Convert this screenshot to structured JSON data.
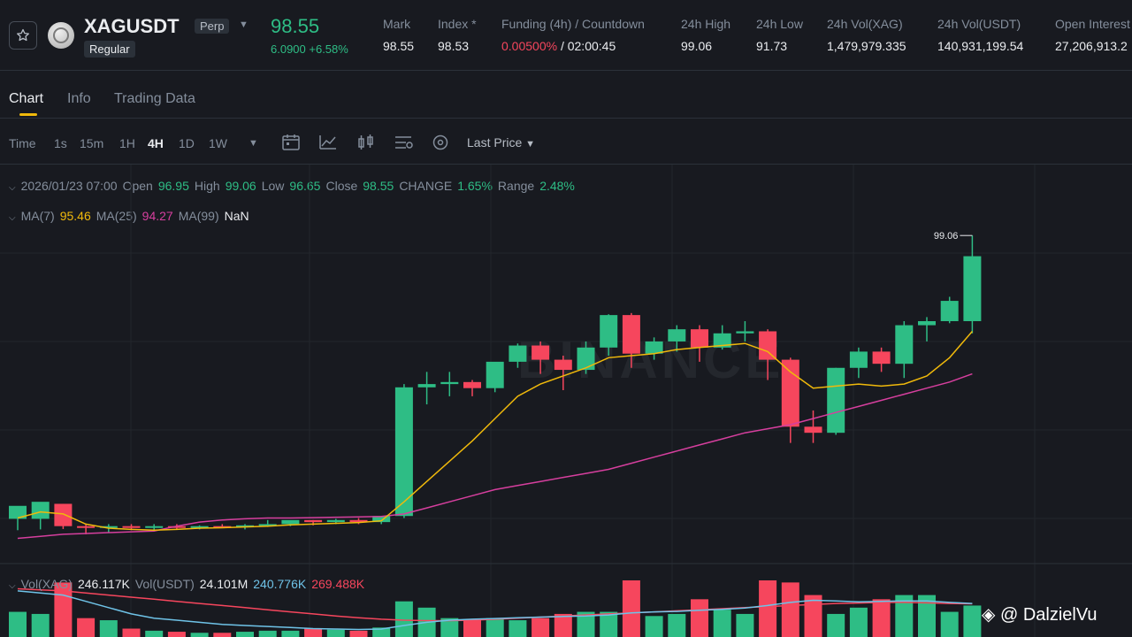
{
  "ticker": {
    "symbol": "XAGUSDT",
    "badge": "Perp",
    "category": "Regular",
    "last_price": "98.55",
    "change": "6.0900 +6.58%",
    "stats": [
      {
        "label": "Mark",
        "value": "98.55"
      },
      {
        "label": "Index *",
        "value": "98.53"
      },
      {
        "label": "Funding (4h) / Countdown",
        "value_rate": "0.00500%",
        "value_countdown": " / 02:00:45"
      },
      {
        "label": "24h High",
        "value": "99.06"
      },
      {
        "label": "24h Low",
        "value": "91.73"
      },
      {
        "label": "24h Vol(XAG)",
        "value": "1,479,979.335"
      },
      {
        "label": "24h Vol(USDT)",
        "value": "140,931,199.54"
      },
      {
        "label": "Open Interest",
        "value": "27,206,913.2"
      }
    ]
  },
  "tabs": [
    "Chart",
    "Info",
    "Trading Data"
  ],
  "toolbar": {
    "timeframes": [
      "Time",
      "1s",
      "15m",
      "1H",
      "4H",
      "1D",
      "1W"
    ],
    "active_timeframe": "4H",
    "price_type": "Last Price"
  },
  "ohlc": {
    "date": "2026/01/23 07:00",
    "open_label": "Open",
    "open": "96.95",
    "high_label": "High",
    "high": "99.06",
    "low_label": "Low",
    "low": "96.65",
    "close_label": "Close",
    "close": "98.55",
    "change_label": "CHANGE",
    "change": "1.65%",
    "range_label": "Range",
    "range": "2.48%"
  },
  "ma": {
    "ma7_label": "MA(7)",
    "ma7": "95.46",
    "ma25_label": "MA(25)",
    "ma25": "94.27",
    "ma99_label": "MA(99)",
    "ma99": "NaN"
  },
  "volume": {
    "label": "Vol(XAG)",
    "value": "246.117K",
    "usdt_label": "Vol(USDT)",
    "usdt_value": "24.101M",
    "ma1": "240.776K",
    "ma2": "269.488K"
  },
  "watermark": "BINANCE",
  "credit": "@ DalzielVu",
  "colors": {
    "up": "#2ebd85",
    "down": "#f6465d",
    "ma7": "#f0b90b",
    "ma25": "#d63f9e",
    "accent": "#f0b90b"
  },
  "chart_data": {
    "type": "candlestick",
    "interval": "4H",
    "high_marker": "99.06",
    "ylim": [
      91.0,
      99.5
    ],
    "candles": [
      {
        "o": 92.08,
        "h": 92.3,
        "c": 92.4,
        "l": 91.8,
        "v": 120
      },
      {
        "o": 92.08,
        "h": 92.48,
        "c": 92.5,
        "l": 91.82,
        "v": 110
      },
      {
        "o": 92.45,
        "h": 92.45,
        "c": 91.9,
        "l": 91.83,
        "v": 260
      },
      {
        "o": 91.9,
        "h": 91.95,
        "c": 91.88,
        "l": 91.7,
        "v": 90
      },
      {
        "o": 91.88,
        "h": 91.95,
        "c": 91.9,
        "l": 91.75,
        "v": 80
      },
      {
        "o": 91.9,
        "h": 91.95,
        "c": 91.88,
        "l": 91.8,
        "v": 40
      },
      {
        "o": 91.88,
        "h": 91.95,
        "c": 91.9,
        "l": 91.8,
        "v": 30
      },
      {
        "o": 91.9,
        "h": 91.95,
        "c": 91.88,
        "l": 91.82,
        "v": 25
      },
      {
        "o": 91.88,
        "h": 91.92,
        "c": 91.9,
        "l": 91.82,
        "v": 20
      },
      {
        "o": 91.9,
        "h": 91.95,
        "c": 91.88,
        "l": 91.85,
        "v": 20
      },
      {
        "o": 91.88,
        "h": 91.95,
        "c": 91.92,
        "l": 91.82,
        "v": 25
      },
      {
        "o": 91.92,
        "h": 92.05,
        "c": 91.95,
        "l": 91.88,
        "v": 30
      },
      {
        "o": 91.95,
        "h": 92.02,
        "c": 92.05,
        "l": 91.9,
        "v": 30
      },
      {
        "o": 92.05,
        "h": 92.05,
        "c": 92.0,
        "l": 91.92,
        "v": 40
      },
      {
        "o": 92.0,
        "h": 92.08,
        "c": 92.05,
        "l": 91.95,
        "v": 35
      },
      {
        "o": 92.05,
        "h": 92.1,
        "c": 92.0,
        "l": 91.95,
        "v": 30
      },
      {
        "o": 92.0,
        "h": 92.12,
        "c": 92.15,
        "l": 91.95,
        "v": 45
      },
      {
        "o": 92.15,
        "h": 95.4,
        "c": 95.32,
        "l": 92.1,
        "v": 170
      },
      {
        "o": 95.32,
        "h": 95.7,
        "c": 95.4,
        "l": 94.9,
        "v": 140
      },
      {
        "o": 95.4,
        "h": 95.7,
        "c": 95.45,
        "l": 95.1,
        "v": 90
      },
      {
        "o": 95.45,
        "h": 95.5,
        "c": 95.3,
        "l": 95.1,
        "v": 80
      },
      {
        "o": 95.3,
        "h": 95.6,
        "c": 95.95,
        "l": 95.2,
        "v": 90
      },
      {
        "o": 95.95,
        "h": 96.4,
        "c": 96.35,
        "l": 95.8,
        "v": 80
      },
      {
        "o": 96.35,
        "h": 96.45,
        "c": 96.0,
        "l": 95.65,
        "v": 90
      },
      {
        "o": 96.0,
        "h": 96.1,
        "c": 95.75,
        "l": 95.25,
        "v": 110
      },
      {
        "o": 95.75,
        "h": 96.45,
        "c": 96.3,
        "l": 95.65,
        "v": 120
      },
      {
        "o": 96.3,
        "h": 97.12,
        "c": 97.1,
        "l": 96.1,
        "v": 120
      },
      {
        "o": 97.1,
        "h": 97.15,
        "c": 96.15,
        "l": 95.8,
        "v": 270
      },
      {
        "o": 96.15,
        "h": 96.55,
        "c": 96.45,
        "l": 96.0,
        "v": 100
      },
      {
        "o": 96.45,
        "h": 96.85,
        "c": 96.75,
        "l": 96.2,
        "v": 110
      },
      {
        "o": 96.75,
        "h": 96.85,
        "c": 96.3,
        "l": 95.95,
        "v": 180
      },
      {
        "o": 96.3,
        "h": 96.85,
        "c": 96.65,
        "l": 96.25,
        "v": 130
      },
      {
        "o": 96.65,
        "h": 96.95,
        "c": 96.7,
        "l": 96.45,
        "v": 110
      },
      {
        "o": 96.7,
        "h": 96.75,
        "c": 96.0,
        "l": 95.5,
        "v": 270
      },
      {
        "o": 96.0,
        "h": 96.05,
        "c": 94.35,
        "l": 93.95,
        "v": 260
      },
      {
        "o": 94.35,
        "h": 94.75,
        "c": 94.2,
        "l": 93.95,
        "v": 200
      },
      {
        "o": 94.2,
        "h": 95.8,
        "c": 95.8,
        "l": 94.15,
        "v": 110
      },
      {
        "o": 95.8,
        "h": 96.3,
        "c": 96.2,
        "l": 95.55,
        "v": 140
      },
      {
        "o": 96.2,
        "h": 96.3,
        "c": 95.9,
        "l": 95.7,
        "v": 180
      },
      {
        "o": 95.9,
        "h": 96.95,
        "c": 96.85,
        "l": 95.55,
        "v": 200
      },
      {
        "o": 96.85,
        "h": 97.05,
        "c": 96.95,
        "l": 96.45,
        "v": 200
      },
      {
        "o": 96.95,
        "h": 97.55,
        "c": 97.45,
        "l": 96.9,
        "v": 120
      },
      {
        "o": 96.95,
        "h": 99.06,
        "c": 98.55,
        "l": 96.65,
        "v": 150
      }
    ],
    "ma7_start_index": 0,
    "ma7": [
      92.1,
      92.25,
      92.2,
      91.95,
      91.85,
      91.82,
      91.8,
      91.82,
      91.85,
      91.86,
      91.88,
      91.9,
      91.93,
      91.95,
      91.97,
      91.99,
      92.03,
      92.5,
      93.0,
      93.5,
      94.0,
      94.55,
      95.1,
      95.4,
      95.6,
      95.8,
      96.05,
      96.1,
      96.15,
      96.25,
      96.3,
      96.35,
      96.4,
      96.2,
      95.7,
      95.3,
      95.35,
      95.4,
      95.35,
      95.4,
      95.6,
      96.05,
      96.7
    ],
    "ma25": [
      91.6,
      91.65,
      91.7,
      91.72,
      91.74,
      91.76,
      91.78,
      91.9,
      92.0,
      92.05,
      92.08,
      92.1,
      92.1,
      92.11,
      92.12,
      92.13,
      92.14,
      92.2,
      92.35,
      92.5,
      92.65,
      92.8,
      92.9,
      93.0,
      93.1,
      93.2,
      93.3,
      93.45,
      93.6,
      93.75,
      93.9,
      94.05,
      94.2,
      94.3,
      94.4,
      94.55,
      94.7,
      94.85,
      95.0,
      95.15,
      95.3,
      95.45,
      95.65
    ],
    "vol_ma1": [
      220,
      210,
      200,
      170,
      140,
      110,
      90,
      80,
      70,
      60,
      55,
      50,
      45,
      40,
      38,
      36,
      38,
      55,
      70,
      80,
      85,
      88,
      92,
      95,
      98,
      100,
      105,
      115,
      120,
      122,
      128,
      132,
      138,
      150,
      165,
      175,
      172,
      168,
      170,
      172,
      172,
      165,
      160
    ],
    "vol_ma2": [
      230,
      225,
      220,
      210,
      200,
      190,
      180,
      170,
      160,
      150,
      140,
      130,
      120,
      110,
      100,
      92,
      85,
      80,
      78,
      78,
      80,
      85,
      90,
      95,
      100,
      105,
      110,
      115,
      120,
      125,
      130,
      135,
      140,
      145,
      150,
      155,
      160,
      162,
      165,
      165,
      163,
      160,
      158
    ]
  }
}
